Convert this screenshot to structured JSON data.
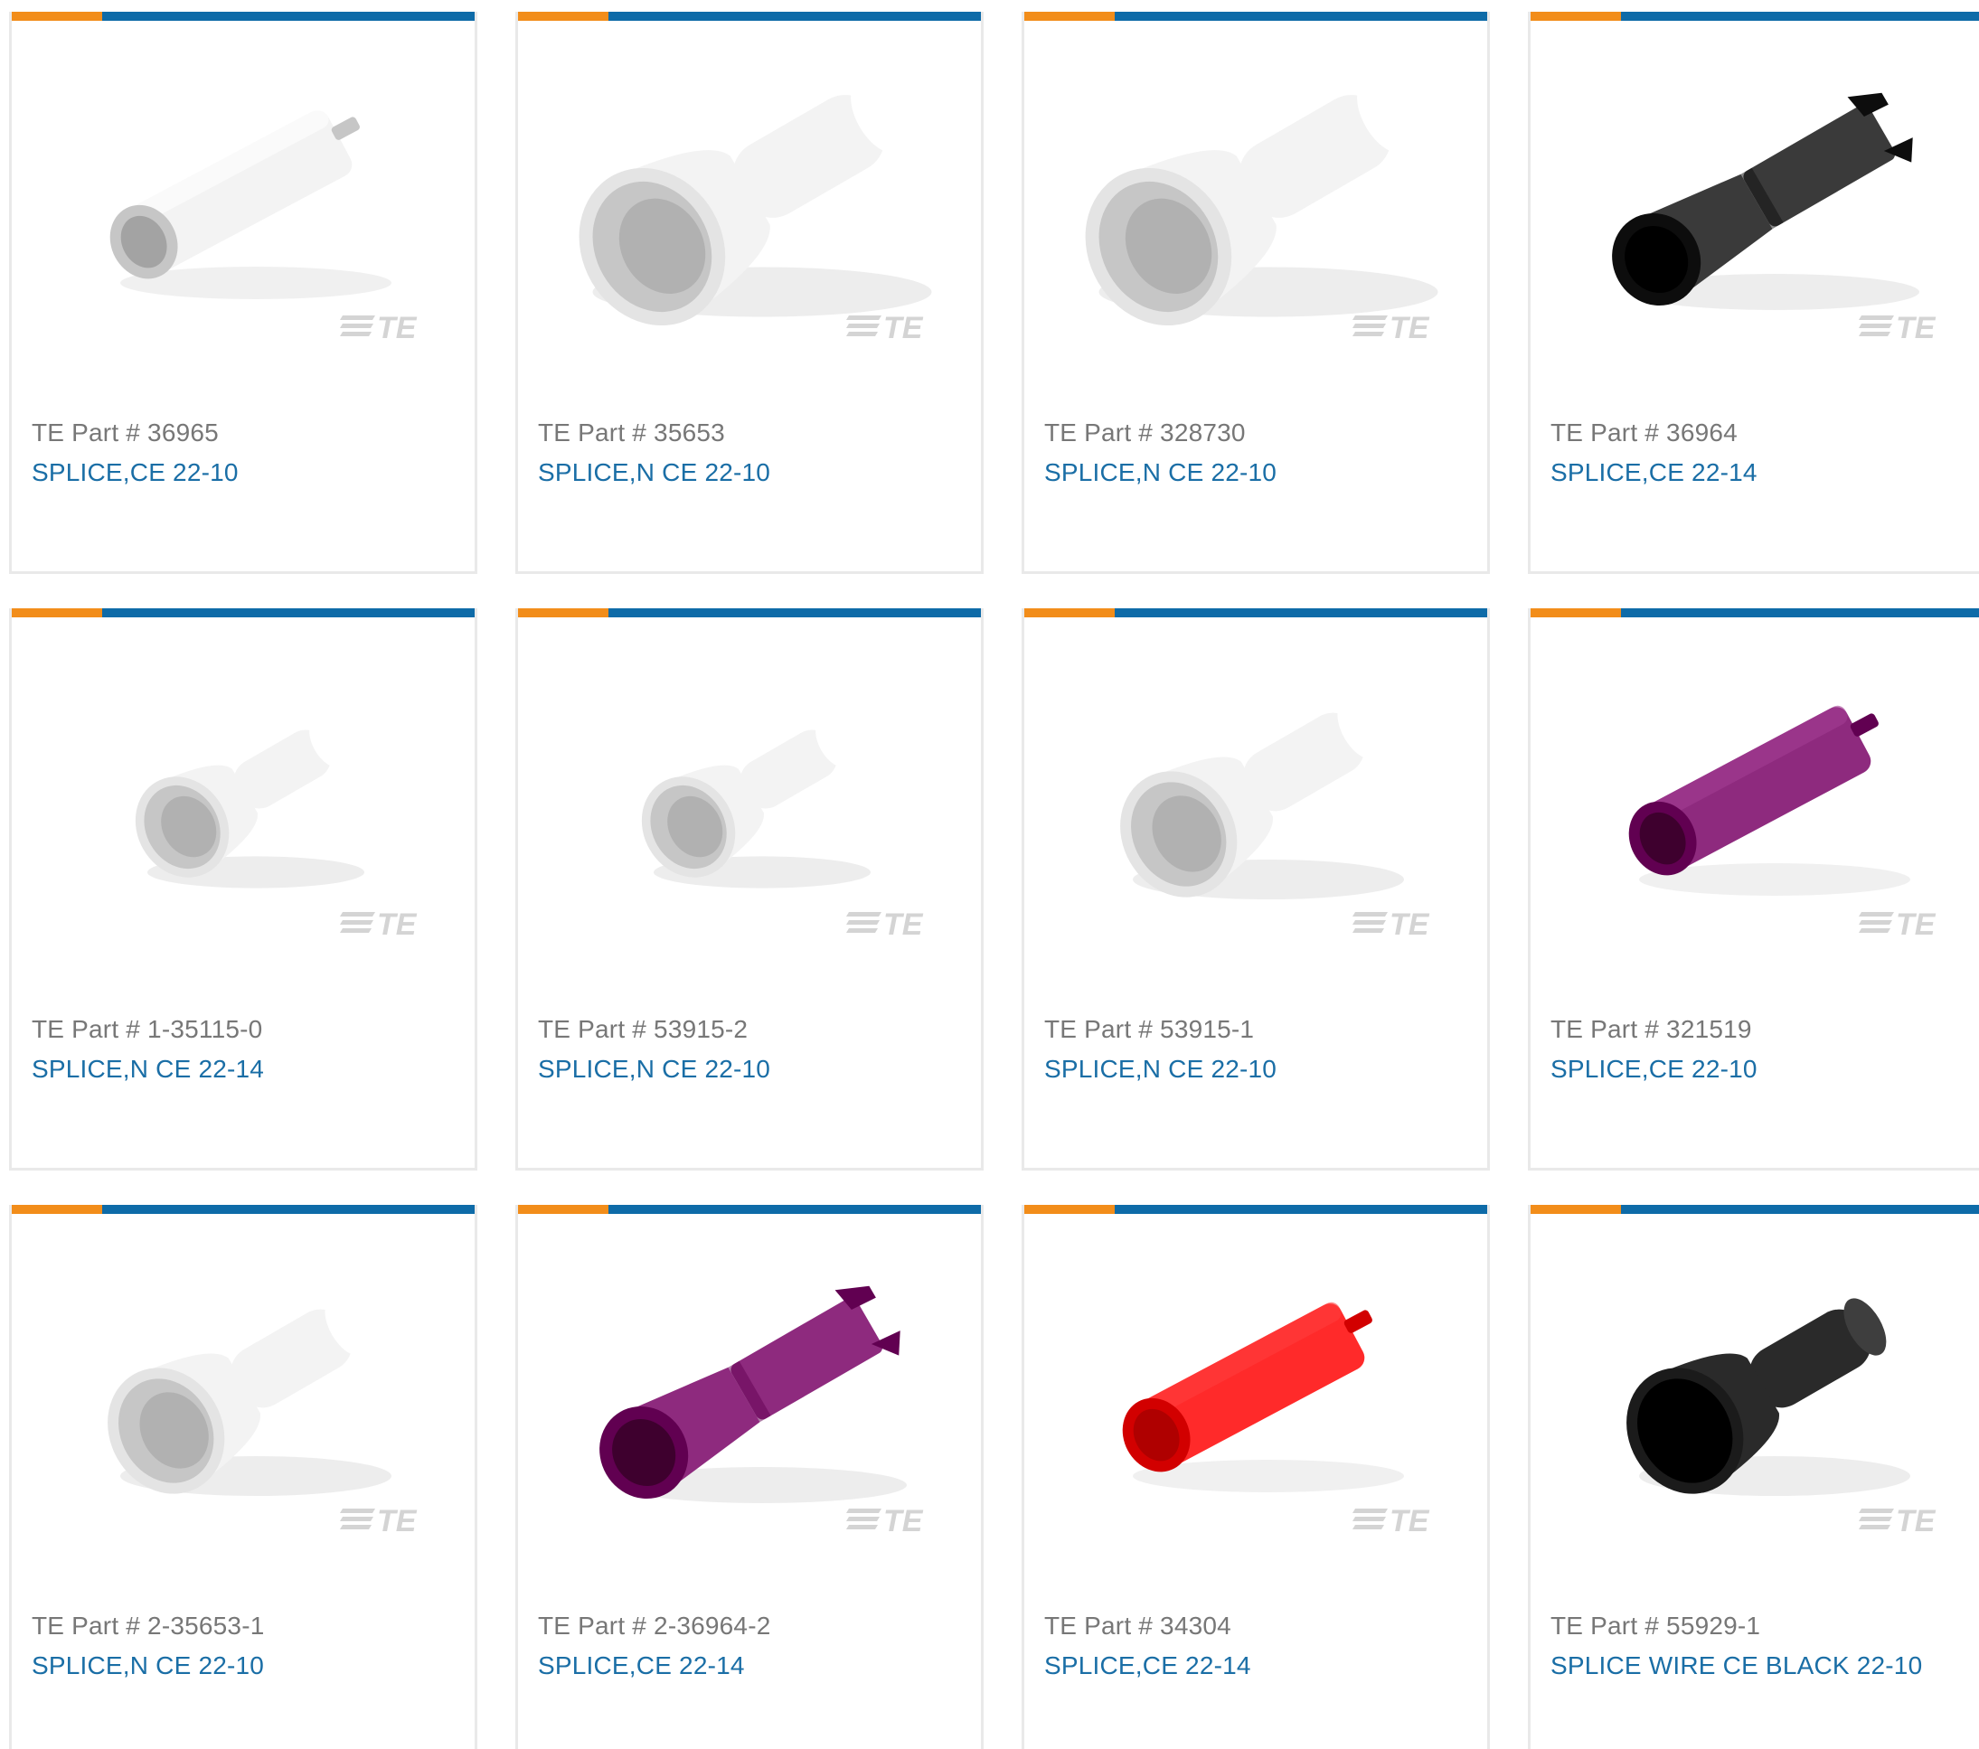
{
  "brand": {
    "accent_orange": "#f28d1a",
    "accent_blue": "#0e6ba8",
    "link_color": "#1a6ea6",
    "logo_text": "TE"
  },
  "products": [
    {
      "part_label": "TE Part #",
      "part_number": "36965",
      "description": "SPLICE,CE 22-10",
      "color": "#f3f3f3",
      "shape": "long-tube"
    },
    {
      "part_label": "TE Part #",
      "part_number": "35653",
      "description": "SPLICE,N CE 22-10",
      "color": "#f3f3f3",
      "shape": "cup-large"
    },
    {
      "part_label": "TE Part #",
      "part_number": "328730",
      "description": "SPLICE,N CE 22-10",
      "color": "#f3f3f3",
      "shape": "cup-large"
    },
    {
      "part_label": "TE Part #",
      "part_number": "36964",
      "description": "SPLICE,CE 22-14",
      "color": "#3a3a3a",
      "shape": "flared-tube"
    },
    {
      "part_label": "TE Part #",
      "part_number": "1-35115-0",
      "description": "SPLICE,N CE 22-14",
      "color": "#f3f3f3",
      "shape": "cup-small"
    },
    {
      "part_label": "TE Part #",
      "part_number": "53915-2",
      "description": "SPLICE,N CE 22-10",
      "color": "#f3f3f3",
      "shape": "cup-small"
    },
    {
      "part_label": "TE Part #",
      "part_number": "53915-1",
      "description": "SPLICE,N CE 22-10",
      "color": "#f3f3f3",
      "shape": "cup-medium"
    },
    {
      "part_label": "TE Part #",
      "part_number": "321519",
      "description": "SPLICE,CE 22-10",
      "color": "#8e2a7e",
      "shape": "long-tube"
    },
    {
      "part_label": "TE Part #",
      "part_number": "2-35653-1",
      "description": "SPLICE,N CE 22-10",
      "color": "#f3f3f3",
      "shape": "cup-medium"
    },
    {
      "part_label": "TE Part #",
      "part_number": "2-36964-2",
      "description": "SPLICE,CE 22-14",
      "color": "#8e2a7e",
      "shape": "flared-tube"
    },
    {
      "part_label": "TE Part #",
      "part_number": "34304",
      "description": "SPLICE,CE 22-14",
      "color": "#ff2a2a",
      "shape": "long-tube"
    },
    {
      "part_label": "TE Part #",
      "part_number": "55929-1",
      "description": "SPLICE WIRE CE BLACK 22-10",
      "color": "#2a2a2a",
      "shape": "cup-medium"
    }
  ]
}
